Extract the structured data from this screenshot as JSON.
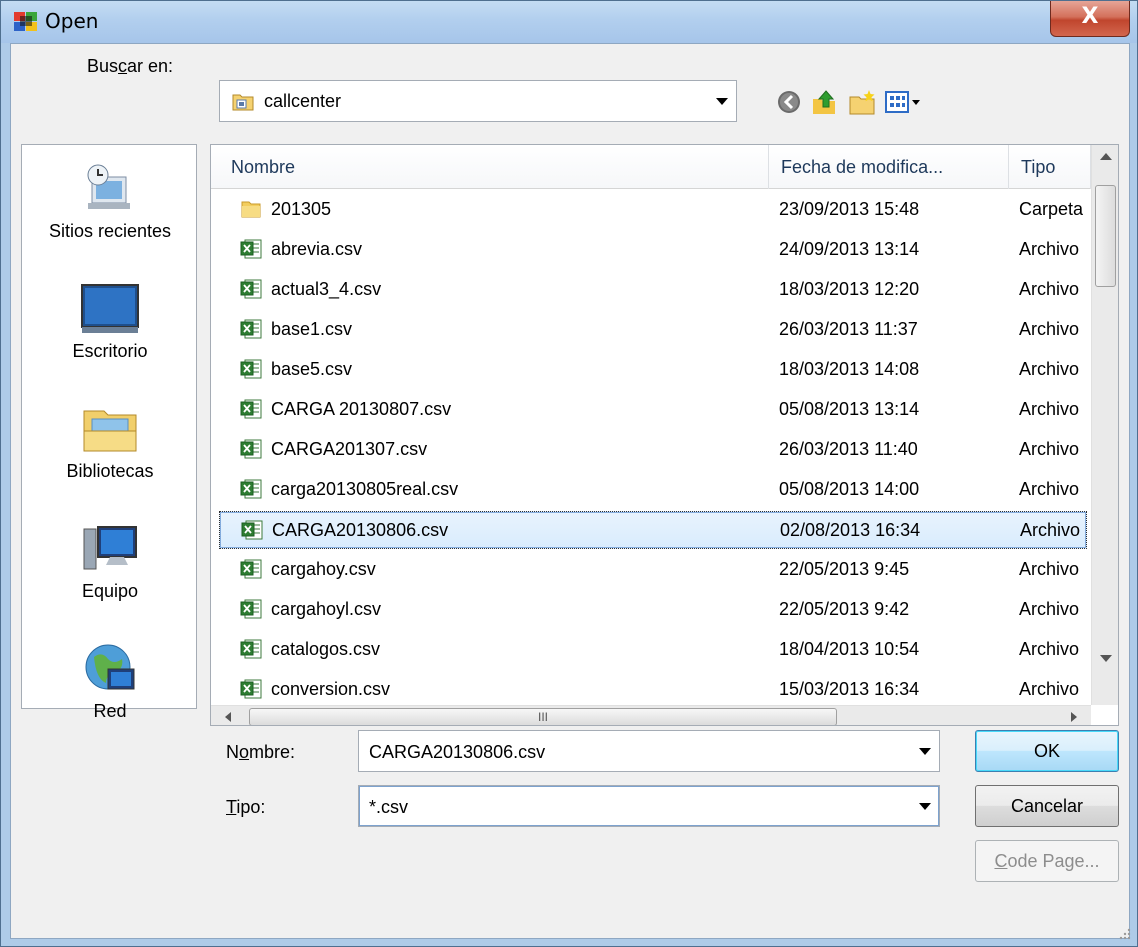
{
  "window": {
    "title": "Open",
    "close_label": "X"
  },
  "lookin": {
    "label_prefix": "Bus",
    "label_accel": "c",
    "label_suffix": "ar en:",
    "value": "callcenter"
  },
  "places": [
    {
      "label": "Sitios recientes",
      "icon": "recent-places-icon"
    },
    {
      "label": "Escritorio",
      "icon": "desktop-icon"
    },
    {
      "label": "Bibliotecas",
      "icon": "libraries-icon"
    },
    {
      "label": "Equipo",
      "icon": "computer-icon"
    },
    {
      "label": "Red",
      "icon": "network-icon"
    }
  ],
  "columns": {
    "name": "Nombre",
    "date": "Fecha de modifica...",
    "type": "Tipo"
  },
  "files": [
    {
      "name": "201305",
      "date": "23/09/2013 15:48",
      "type": "Carpeta",
      "icon": "folder-icon"
    },
    {
      "name": "abrevia.csv",
      "date": "24/09/2013 13:14",
      "type": "Archivo",
      "icon": "excel-csv-icon"
    },
    {
      "name": "actual3_4.csv",
      "date": "18/03/2013 12:20",
      "type": "Archivo",
      "icon": "excel-csv-icon"
    },
    {
      "name": "base1.csv",
      "date": "26/03/2013 11:37",
      "type": "Archivo",
      "icon": "excel-csv-icon"
    },
    {
      "name": "base5.csv",
      "date": "18/03/2013 14:08",
      "type": "Archivo",
      "icon": "excel-csv-icon"
    },
    {
      "name": "CARGA 20130807.csv",
      "date": "05/08/2013 13:14",
      "type": "Archivo",
      "icon": "excel-csv-icon"
    },
    {
      "name": "CARGA201307.csv",
      "date": "26/03/2013 11:40",
      "type": "Archivo",
      "icon": "excel-csv-icon"
    },
    {
      "name": "carga20130805real.csv",
      "date": "05/08/2013 14:00",
      "type": "Archivo",
      "icon": "excel-csv-icon"
    },
    {
      "name": "CARGA20130806.csv",
      "date": "02/08/2013 16:34",
      "type": "Archivo",
      "icon": "excel-csv-icon",
      "selected": true
    },
    {
      "name": "cargahoy.csv",
      "date": "22/05/2013 9:45",
      "type": "Archivo",
      "icon": "excel-csv-icon"
    },
    {
      "name": "cargahoyl.csv",
      "date": "22/05/2013 9:42",
      "type": "Archivo",
      "icon": "excel-csv-icon"
    },
    {
      "name": "catalogos.csv",
      "date": "18/04/2013 10:54",
      "type": "Archivo",
      "icon": "excel-csv-icon"
    },
    {
      "name": "conversion.csv",
      "date": "15/03/2013 16:34",
      "type": "Archivo",
      "icon": "excel-csv-icon"
    }
  ],
  "hscroll_grip": "III",
  "filename": {
    "label_prefix": "N",
    "label_accel": "o",
    "label_suffix": "mbre:",
    "value": "CARGA20130806.csv"
  },
  "filetype": {
    "label_accel": "T",
    "label_suffix": "ipo:",
    "value": "*.csv"
  },
  "buttons": {
    "ok": "OK",
    "cancel": "Cancelar",
    "codepage_accel": "C",
    "codepage_suffix": "ode Page..."
  },
  "colors": {
    "title_gradient_top": "#c4dcf3",
    "close_red": "#c0462e",
    "selection": "#d9ecfd"
  }
}
